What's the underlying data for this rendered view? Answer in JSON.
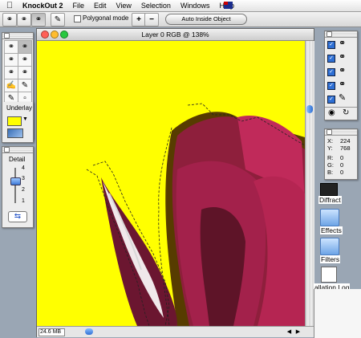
{
  "menubar": {
    "app_name": "KnockOut 2",
    "items": [
      "File",
      "Edit",
      "View",
      "Selection",
      "Windows",
      "Help"
    ]
  },
  "toolbar": {
    "polygonal_mode_label": "Polygonal mode",
    "auto_inside_object_label": "Auto Inside Object",
    "plus_label": "+",
    "minus_label": "−"
  },
  "tools_palette": {
    "underlay_label": "Underlay",
    "underlay_color": "#ffff00"
  },
  "detail_palette": {
    "title": "Detail",
    "ticks": [
      "4",
      "3",
      "2",
      "1"
    ]
  },
  "document": {
    "title": "Layer 0 RGB @ 138%",
    "memory_size": "24.6 MB",
    "canvas_color": "#ffff00"
  },
  "info_palette": {
    "x_label": "X:",
    "x_value": "224",
    "y_label": "Y:",
    "y_value": "768",
    "r_label": "R:",
    "r_value": "0",
    "g_label": "G:",
    "g_value": "0",
    "b_label": "B:",
    "b_value": "0"
  },
  "desktop": {
    "items": [
      "Diffract",
      "Effects",
      "Filters",
      "allation Log"
    ]
  }
}
